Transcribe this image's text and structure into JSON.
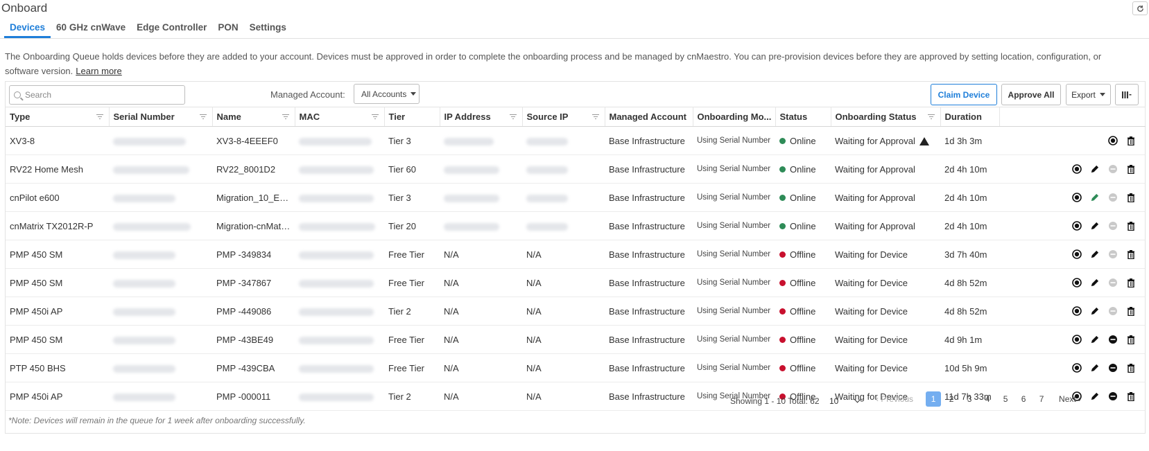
{
  "page": {
    "title": "Onboard",
    "tabs": [
      "Devices",
      "60 GHz cnWave",
      "Edge Controller",
      "PON",
      "Settings"
    ],
    "intro": "The Onboarding Queue holds devices before they are added to your account. Devices must be approved in order to complete the onboarding process and be managed by cnMaestro. You can pre-provision devices before they are approved by setting location, configuration, or software version.",
    "learn_more": "Learn more",
    "note": "*Note: Devices will remain in the queue for 1 week after onboarding successfully."
  },
  "toolbar": {
    "search_placeholder": "Search",
    "managed_account_label": "Managed Account:",
    "managed_account_value": "All Accounts",
    "claim_label": "Claim Device",
    "approve_label": "Approve All",
    "export_label": "Export",
    "columns_icon": "columns-icon"
  },
  "table": {
    "columns": [
      "Type",
      "Serial Number",
      "Name",
      "MAC",
      "Tier",
      "IP Address",
      "Source IP",
      "Managed Account",
      "Onboarding Mo...",
      "Status",
      "Onboarding Status",
      "Duration"
    ],
    "rows": [
      {
        "type": "XV3-8",
        "name": "XV3-8-4EEEF0",
        "tier": "Tier 3",
        "ip": "",
        "source_ip": "",
        "account": "Base Infrastructure",
        "mode": "Using Serial Number",
        "status": "Online",
        "onboarding": "Waiting for Approval",
        "duration": "1d 3h 3m"
      },
      {
        "type": "RV22 Home Mesh",
        "name": "RV22_8001D2",
        "tier": "Tier 60",
        "ip": "",
        "source_ip": "",
        "account": "Base Infrastructure",
        "mode": "Using Serial Number",
        "status": "Online",
        "onboarding": "Waiting for Approval",
        "duration": "2d 4h 10m"
      },
      {
        "type": "cnPilot e600",
        "name": "Migration_10_E6...",
        "tier": "Tier 3",
        "ip": "",
        "source_ip": "",
        "account": "Base Infrastructure",
        "mode": "Using Serial Number",
        "status": "Online",
        "onboarding": "Waiting for Approval",
        "duration": "2d 4h 10m"
      },
      {
        "type": "cnMatrix TX2012R-P",
        "name": "Migration-cnMatr...",
        "tier": "Tier 20",
        "ip": "",
        "source_ip": "",
        "account": "Base Infrastructure",
        "mode": "Using Serial Number",
        "status": "Online",
        "onboarding": "Waiting for Approval",
        "duration": "2d 4h 10m"
      },
      {
        "type": "PMP 450 SM",
        "name": "PMP -349834",
        "tier": "Free Tier",
        "ip": "N/A",
        "source_ip": "N/A",
        "account": "Base Infrastructure",
        "mode": "Using Serial Number",
        "status": "Offline",
        "onboarding": "Waiting for Device",
        "duration": "3d 7h 40m"
      },
      {
        "type": "PMP 450 SM",
        "name": "PMP -347867",
        "tier": "Free Tier",
        "ip": "N/A",
        "source_ip": "N/A",
        "account": "Base Infrastructure",
        "mode": "Using Serial Number",
        "status": "Offline",
        "onboarding": "Waiting for Device",
        "duration": "4d 8h 52m"
      },
      {
        "type": "PMP 450i AP",
        "name": "PMP -449086",
        "tier": "Tier 2",
        "ip": "N/A",
        "source_ip": "N/A",
        "account": "Base Infrastructure",
        "mode": "Using Serial Number",
        "status": "Offline",
        "onboarding": "Waiting for Device",
        "duration": "4d 8h 52m"
      },
      {
        "type": "PMP 450 SM",
        "name": "PMP -43BE49",
        "tier": "Free Tier",
        "ip": "N/A",
        "source_ip": "N/A",
        "account": "Base Infrastructure",
        "mode": "Using Serial Number",
        "status": "Offline",
        "onboarding": "Waiting for Device",
        "duration": "4d 9h 1m"
      },
      {
        "type": "PTP 450 BHS",
        "name": "PMP -439CBA",
        "tier": "Free Tier",
        "ip": "N/A",
        "source_ip": "N/A",
        "account": "Base Infrastructure",
        "mode": "Using Serial Number",
        "status": "Offline",
        "onboarding": "Waiting for Device",
        "duration": "10d 5h 9m"
      },
      {
        "type": "PMP 450i AP",
        "name": "PMP -000011",
        "tier": "Tier 2",
        "ip": "N/A",
        "source_ip": "N/A",
        "account": "Base Infrastructure",
        "mode": "Using Serial Number",
        "status": "Offline",
        "onboarding": "Waiting for Device",
        "duration": "11d 7h 33m"
      }
    ]
  },
  "pagination": {
    "showing": "Showing 1 - 10 Total: 62",
    "page_size": "10",
    "previous": "Previous",
    "next": "Next",
    "pages": [
      "1",
      "2",
      "3",
      "4",
      "5",
      "6",
      "7"
    ],
    "current": "1"
  },
  "colors": {
    "accent": "#1e7ed9",
    "online": "#2e8b57",
    "offline": "#c8102e",
    "current_page": "#74aef0"
  }
}
